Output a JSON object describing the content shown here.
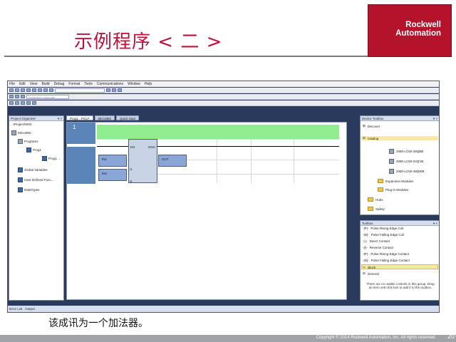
{
  "slide": {
    "title": "示例程序 < 二 >",
    "logo": [
      "Rockwell",
      "Automation"
    ],
    "caption": "该成讯为一个加法器。",
    "footer": "Copyright © 2014 Rockwell Automation, Inc. All rights reserved.",
    "page_number": "20"
  },
  "app": {
    "menu": [
      "File",
      "Edit",
      "View",
      "Build",
      "Debug",
      "Format",
      "Tools",
      "Communications",
      "Window",
      "Help"
    ],
    "toolbar_combo2_placeholder": "Application language"
  },
  "project_organizer": {
    "header": "Project Organizer",
    "path": "...\\Project\\SM1",
    "items": [
      "Micro850",
      "Programs",
      "Prog1",
      "Prog1 ...",
      "Global Variables",
      "User-Defined Func...",
      "DataTypes"
    ]
  },
  "editor": {
    "tabs": [
      "Prog1 - POU*",
      "Micro850",
      "Quick Start"
    ],
    "rung_number": "1",
    "block_in": "EN",
    "block_out": "ENO",
    "var_in1": "IN1",
    "var_in2": "IN2",
    "var_out": "OUT",
    "input_labels": [
      "i1",
      "i2"
    ]
  },
  "properties": {
    "header": "Device Toolbox",
    "sections": [
      "Discover",
      "Catalog"
    ],
    "items": [
      "2080-LC50-48QBB",
      "2080-LC50-24QVB",
      "2080-LC50-48QWB",
      "Expansion Modules",
      "Plug-in Modules",
      "Hubs",
      "Safety"
    ]
  },
  "toolbox": {
    "header": "Toolbox",
    "items": [
      "Pulse Rising Edge Coil",
      "Pulse Falling Edge Coil",
      "Direct Contact",
      "Reverse Contact",
      "Pulse Rising Edge Contact",
      "Pulse Falling Edge Contact",
      "Block"
    ],
    "section": "General",
    "hint": "There are no usable controls in this group. Drag an item onto this text to add it to the toolbox."
  },
  "statusbar": [
    "Error List",
    "Output"
  ]
}
